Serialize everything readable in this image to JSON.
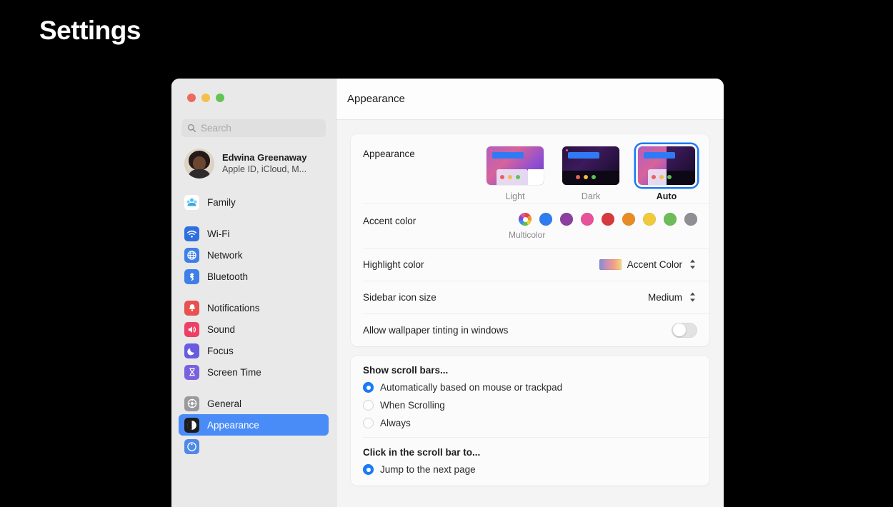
{
  "page": {
    "title": "Settings"
  },
  "window": {
    "toolbar_title": "Appearance"
  },
  "sidebar": {
    "search": {
      "placeholder": "Search",
      "value": ""
    },
    "account": {
      "name": "Edwina Greenaway",
      "subtitle": "Apple ID, iCloud, M..."
    },
    "groups": [
      {
        "items": [
          {
            "label": "Family",
            "icon": "family-icon",
            "selected": false
          }
        ]
      },
      {
        "items": [
          {
            "label": "Wi-Fi",
            "icon": "wifi-icon",
            "selected": false
          },
          {
            "label": "Network",
            "icon": "network-icon",
            "selected": false
          },
          {
            "label": "Bluetooth",
            "icon": "bluetooth-icon",
            "selected": false
          }
        ]
      },
      {
        "items": [
          {
            "label": "Notifications",
            "icon": "bell-icon",
            "selected": false
          },
          {
            "label": "Sound",
            "icon": "speaker-icon",
            "selected": false
          },
          {
            "label": "Focus",
            "icon": "moon-icon",
            "selected": false
          },
          {
            "label": "Screen Time",
            "icon": "hourglass-icon",
            "selected": false
          }
        ]
      },
      {
        "items": [
          {
            "label": "General",
            "icon": "gear-icon",
            "selected": false
          },
          {
            "label": "Appearance",
            "icon": "appearance-icon",
            "selected": true
          }
        ]
      }
    ]
  },
  "main": {
    "appearance": {
      "label": "Appearance",
      "themes": [
        {
          "label": "Light",
          "selected": false
        },
        {
          "label": "Dark",
          "selected": false
        },
        {
          "label": "Auto",
          "selected": true
        }
      ]
    },
    "accent_color": {
      "label": "Accent color",
      "caption": "Multicolor",
      "swatches": [
        {
          "name": "Multicolor",
          "color": "multicolor"
        },
        {
          "name": "Blue",
          "color": "#2f7cf0"
        },
        {
          "name": "Purple",
          "color": "#8b3f9e"
        },
        {
          "name": "Pink",
          "color": "#e8529b"
        },
        {
          "name": "Red",
          "color": "#d63a3f"
        },
        {
          "name": "Orange",
          "color": "#e98b24"
        },
        {
          "name": "Yellow",
          "color": "#f0ca3c"
        },
        {
          "name": "Green",
          "color": "#6cbc57"
        },
        {
          "name": "Graphite",
          "color": "#8e8e93"
        }
      ]
    },
    "highlight_color": {
      "label": "Highlight color",
      "value": "Accent Color"
    },
    "sidebar_icon_size": {
      "label": "Sidebar icon size",
      "value": "Medium"
    },
    "wallpaper_tinting": {
      "label": "Allow wallpaper tinting in windows",
      "enabled": false
    },
    "show_scroll_bars": {
      "heading": "Show scroll bars...",
      "options": [
        {
          "label": "Automatically based on mouse or trackpad",
          "selected": true
        },
        {
          "label": "When Scrolling",
          "selected": false
        },
        {
          "label": "Always",
          "selected": false
        }
      ]
    },
    "click_scroll_bar": {
      "heading": "Click in the scroll bar to...",
      "options": [
        {
          "label": "Jump to the next page",
          "selected": true
        }
      ]
    }
  }
}
